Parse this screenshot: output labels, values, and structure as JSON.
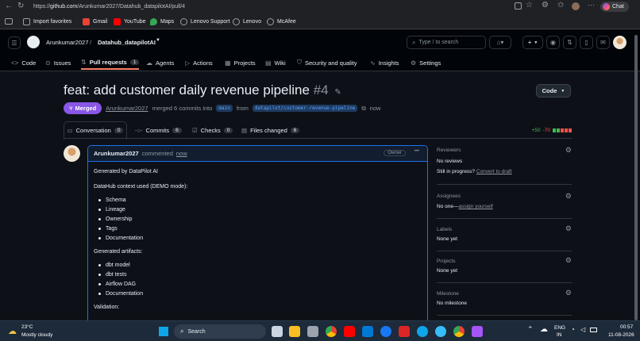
{
  "browser": {
    "url_prefix": "https://",
    "url_domain": "github.com",
    "url_path": "/Arunkumar2027/Datahub_datapilotAI/pull/4",
    "chat_label": "Chat",
    "bookmarks": [
      "Import favorites",
      "Gmail",
      "YouTube",
      "Maps",
      "Lenovo Support",
      "Lenovo",
      "McAfee"
    ]
  },
  "header": {
    "owner": "Arunkumar2027",
    "separator": "/",
    "repo": "Datahub_datapilotAI",
    "search_placeholder": "Type / to search",
    "plus_label": "+",
    "tabs": [
      {
        "label": "Code",
        "icon": "code-icon",
        "count": ""
      },
      {
        "label": "Issues",
        "icon": "issue-icon",
        "count": ""
      },
      {
        "label": "Pull requests",
        "icon": "pr-icon",
        "count": "1"
      },
      {
        "label": "Agents",
        "icon": "agent-icon",
        "count": ""
      },
      {
        "label": "Actions",
        "icon": "play-icon",
        "count": ""
      },
      {
        "label": "Projects",
        "icon": "table-icon",
        "count": ""
      },
      {
        "label": "Wiki",
        "icon": "book-icon",
        "count": ""
      },
      {
        "label": "Security and quality",
        "icon": "shield-icon",
        "count": ""
      },
      {
        "label": "Insights",
        "icon": "graph-icon",
        "count": ""
      },
      {
        "label": "Settings",
        "icon": "gear-icon",
        "count": ""
      }
    ]
  },
  "pr": {
    "title": "feat: add customer daily revenue pipeline",
    "number": "#4",
    "state": "Merged",
    "author": "Arunkumar2027",
    "merge_text": "merged 6 commits into",
    "base_branch": "main",
    "from_text": "from",
    "head_branch": "datapilot/customer-revenue-pipeline",
    "time": "now",
    "code_button": "Code",
    "subtabs": [
      {
        "label": "Conversation",
        "count": "0"
      },
      {
        "label": "Commits",
        "count": "6"
      },
      {
        "label": "Checks",
        "count": "0"
      },
      {
        "label": "Files changed",
        "count": "6"
      }
    ],
    "additions": "+50",
    "deletions": "-70"
  },
  "comment": {
    "author": "Arunkumar2027",
    "action": "commented",
    "time": "now",
    "role": "Owner",
    "menu": "•••",
    "line1": "Generated by DataPilot AI",
    "line2": "DataHub context used (DEMO mode):",
    "context_items": [
      "Schema",
      "Lineage",
      "Ownership",
      "Tags",
      "Documentation"
    ],
    "line3": "Generated artifacts:",
    "artifact_items": [
      "dbt model",
      "dbt tests",
      "Airflow DAG",
      "Documentation"
    ],
    "line4": "Validation:"
  },
  "sidebar": {
    "reviewers_title": "Reviewers",
    "reviewers_value": "No reviews",
    "in_progress": "Still in progress?",
    "convert_link": "Convert to draft",
    "assignees_title": "Assignees",
    "assignees_value": "No one—",
    "assign_link": "assign yourself",
    "labels_title": "Labels",
    "labels_value": "None yet",
    "projects_title": "Projects",
    "projects_value": "None yet",
    "milestone_title": "Milestone",
    "milestone_value": "No milestone"
  },
  "taskbar": {
    "temp": "23°C",
    "weather": "Mostly cloudy",
    "search": "Search",
    "lang1": "ENG",
    "lang2": "IN",
    "time": "00:57",
    "date": "11-08-2026"
  },
  "colors": {
    "merged": "#8957e5",
    "link": "#4493f8",
    "add": "#3fb950",
    "del": "#f85149"
  }
}
